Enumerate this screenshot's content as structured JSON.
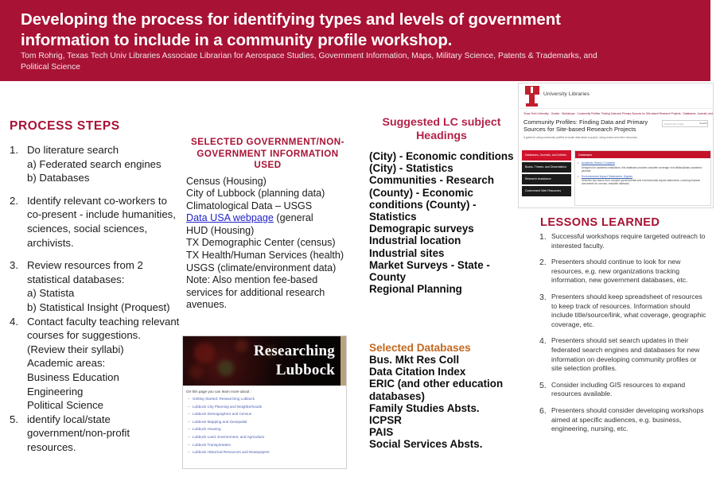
{
  "header": {
    "title": "Developing the process for identifying types and levels of government information to include in a community profile workshop.",
    "authors": "Tom Rohrig, Texas Tech Univ Libraries Associate Librarian for Aerospace Studies, Government Information, Maps, Military Science, Patents & Trademarks, and Political Science",
    "background_color": "#A81234"
  },
  "process_steps": {
    "heading": "PROCESS STEPS",
    "items": [
      {
        "num": "1.",
        "lines": [
          "Do literature search",
          "a) Federated search engines",
          "b) Databases"
        ]
      },
      {
        "num": "2.",
        "lines": [
          "Identify relevant co-workers to co-present - include humanities, sciences, social sciences, archivists."
        ]
      },
      {
        "num": "3.",
        "lines": [
          "Review resources from 2 statistical databases:",
          "a) Statista",
          "b) Statistical Insight (Proquest)"
        ]
      },
      {
        "num": "4.",
        "lines": [
          "Contact faculty teaching relevant courses for suggestions. (Review their syllabi)",
          "Academic areas:",
          "Business      Education",
          "Engineering",
          "Political Science"
        ]
      },
      {
        "num": "5.",
        "lines": [
          "identify local/state government/non-profit resources."
        ]
      }
    ]
  },
  "gov_info": {
    "heading": "SELECTED GOVERNMENT/NON-GOVERNMENT INFORMATION USED",
    "lines": [
      "Census (Housing)",
      "City of Lubbock (planning data)",
      "Climatological Data – USGS",
      "HUD (Housing)",
      "TX Demographic Center (census)",
      "TX Health/Human Services (health)",
      "USGS (climate/environment data)",
      "Note:  Also mention fee-based services for additional research avenues."
    ],
    "link_label": "Data USA webpage",
    "link_suffix": " (general",
    "link_color": "#2222cc"
  },
  "lubbock_screenshot": {
    "banner_title_line1": "Researching",
    "banner_title_line2": "Lubbock",
    "caption": "On this page you can learn more about :",
    "links": [
      "Getting Started: Researching Lubbock",
      "Lubbock City Planning and Neighborhoods",
      "Lubbock Demographics and Census",
      "Lubbock Mapping and Geospatial",
      "Lubbock Housing",
      "Lubbock Land, Environment, and Agriculture",
      "Lubbock Transportation",
      "Lubbock Historical Resources and Newspapers"
    ]
  },
  "lc_headings": {
    "heading": "Suggested LC subject Headings",
    "items": [
      "(City) - Economic conditions",
      "(City) - Statistics",
      "Communities - Research",
      "(County) - Economic conditions   (County) - Statistics",
      "Demograpic surveys",
      "Industrial location",
      "Industrial sites",
      "Market Surveys - State - County",
      "Regional Planning"
    ]
  },
  "databases": {
    "heading": "Selected Databases",
    "heading_color": "#C4681E",
    "items": [
      "Bus. Mkt Res Coll",
      "Data Citation Index",
      "ERIC (and other education databases)",
      "Family Studies Absts.",
      "ICPSR",
      "PAIS",
      "Social Services Absts."
    ]
  },
  "guide_screenshot": {
    "logo_text": "University Libraries",
    "breadcrumb": "Texas Tech University · Guides · Workshops · Community Profiles: Finding Data and Primary Sources for Site-based Research Projects · Databases, Journals, and Articles",
    "page_title": "Community Profiles: Finding Data and Primary Sources for Site-based Research Projects",
    "search_placeholder": "Search this Guide",
    "search_button": "Search",
    "description": "A guide for using community profiles to locate data about a project, using census and other resources.",
    "nav_items": [
      "Databases, Journals, and Articles",
      "Books, Theses, and Dissertations",
      "Research Assistance",
      "Government Web Resources"
    ],
    "panel_header": "Databases",
    "panel_entries": [
      {
        "link": "Academic Search Complete",
        "text": "Designed for academic institutions, this database provides complete coverage of multidisciplinary academic journals."
      },
      {
        "link": "Environmental Impact Statements: Digests",
        "text": "Selective key issues from complex governmental and environmental impact statements, covering massive documents for concise, readable abstracts."
      }
    ]
  },
  "lessons_learned": {
    "heading": "LESSONS LEARNED",
    "items": [
      {
        "num": "1.",
        "text": "Successful workshops require targeted outreach to interested faculty."
      },
      {
        "num": "2.",
        "text": "Presenters should continue to look for new resources, e.g. new organizations tracking information, new government databases, etc."
      },
      {
        "num": "3.",
        "text": "Presenters should keep spreadsheet of resources to keep track of resources. Information should include title/source/link, what coverage, geographic coverage, etc."
      },
      {
        "num": "4.",
        "text": "Presenters should set search updates in their federated search engines and databases for new information on developing community profiles or site selection profiles."
      },
      {
        "num": "5.",
        "text": "Consider including GIS resources to expand resources available."
      },
      {
        "num": "6.",
        "text": "Presenters should consider developing workshops aimed at specific audiences, e.g. business, engineering, nursing, etc."
      }
    ]
  }
}
